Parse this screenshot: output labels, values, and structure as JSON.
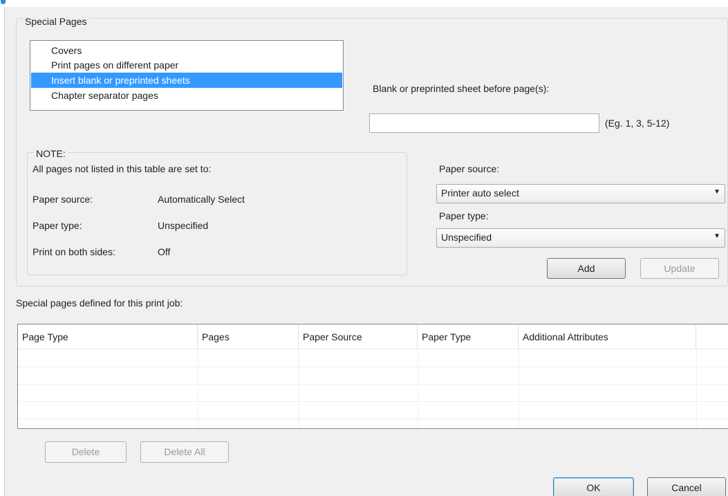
{
  "special_pages": {
    "group_title": "Special Pages",
    "list": [
      {
        "label": "Covers",
        "selected": false
      },
      {
        "label": "Print pages on different paper",
        "selected": false
      },
      {
        "label": "Insert blank or preprinted sheets",
        "selected": true
      },
      {
        "label": "Chapter separator pages",
        "selected": false
      }
    ],
    "sheet_label": "Blank or preprinted sheet before page(s):",
    "sheet_value": "",
    "sheet_hint": "(Eg. 1, 3, 5-12)"
  },
  "note": {
    "title": "NOTE:",
    "intro": "All pages not listed in this table are set to:",
    "rows": [
      {
        "label": "Paper source:",
        "value": "Automatically Select"
      },
      {
        "label": "Paper type:",
        "value": "Unspecified"
      },
      {
        "label": "Print on both sides:",
        "value": "Off"
      }
    ]
  },
  "form": {
    "paper_source_label": "Paper source:",
    "paper_source_value": "Printer auto select",
    "paper_type_label": "Paper type:",
    "paper_type_value": "Unspecified",
    "add_label": "Add",
    "update_label": "Update"
  },
  "defined": {
    "title": "Special pages defined for this print job:",
    "columns": [
      "Page Type",
      "Pages",
      "Paper Source",
      "Paper Type",
      "Additional Attributes"
    ],
    "delete_label": "Delete",
    "delete_all_label": "Delete All"
  },
  "footer": {
    "ok_label": "OK",
    "cancel_label": "Cancel"
  },
  "icons": {
    "dropdown": "chevron-down-icon",
    "caption": "info-icon"
  },
  "colors": {
    "selection": "#3399ff",
    "dialog_bg": "#f0f0f0"
  }
}
